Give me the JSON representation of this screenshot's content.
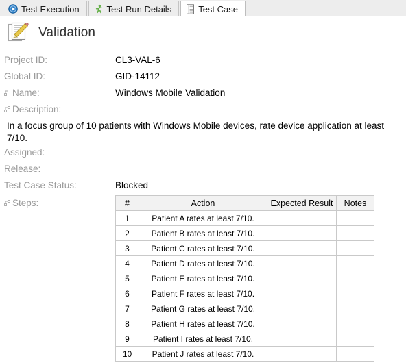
{
  "tabs": [
    {
      "label": "Test Execution",
      "icon": "play-circle-icon",
      "active": false
    },
    {
      "label": "Test Run Details",
      "icon": "runner-icon",
      "active": false
    },
    {
      "label": "Test Case",
      "icon": "document-lines-icon",
      "active": true
    }
  ],
  "header": {
    "title": "Validation",
    "icon": "document-pencil-icon"
  },
  "fields": [
    {
      "label": "Project ID:",
      "value": "CL3-VAL-6",
      "node": false
    },
    {
      "label": "Global ID:",
      "value": "GID-14112",
      "node": false
    },
    {
      "label": "Name:",
      "value": "Windows Mobile Validation",
      "node": true
    }
  ],
  "description": {
    "label": "Description:",
    "node": true,
    "text": "In a focus group of 10 patients with Windows Mobile devices, rate device application at least 7/10."
  },
  "fields2": [
    {
      "label": "Assigned:",
      "value": "",
      "node": false
    },
    {
      "label": "Release:",
      "value": "",
      "node": false
    },
    {
      "label": "Test Case Status:",
      "value": "Blocked",
      "node": false
    }
  ],
  "steps": {
    "label": "Steps:",
    "node": true,
    "columns": [
      "#",
      "Action",
      "Expected Result",
      "Notes"
    ],
    "rows": [
      {
        "num": "1",
        "action": "Patient A rates at least 7/10.",
        "expected": "",
        "notes": ""
      },
      {
        "num": "2",
        "action": "Patient B rates at least 7/10.",
        "expected": "",
        "notes": ""
      },
      {
        "num": "3",
        "action": "Patient C rates at least 7/10.",
        "expected": "",
        "notes": ""
      },
      {
        "num": "4",
        "action": "Patient D rates at least 7/10.",
        "expected": "",
        "notes": ""
      },
      {
        "num": "5",
        "action": "Patient E rates at least 7/10.",
        "expected": "",
        "notes": ""
      },
      {
        "num": "6",
        "action": "Patient F rates at least 7/10.",
        "expected": "",
        "notes": ""
      },
      {
        "num": "7",
        "action": "Patient G rates at least 7/10.",
        "expected": "",
        "notes": ""
      },
      {
        "num": "8",
        "action": "Patient H rates at least 7/10.",
        "expected": "",
        "notes": ""
      },
      {
        "num": "9",
        "action": "Patient I rates at least 7/10.",
        "expected": "",
        "notes": ""
      },
      {
        "num": "10",
        "action": "Patient J rates at least 7/10.",
        "expected": "",
        "notes": ""
      }
    ]
  },
  "colors": {
    "tabbar_bg": "#ededed",
    "label_gray": "#9a9a9a",
    "title_gray": "#333333",
    "table_header_bg": "#f2f2f2",
    "table_border": "#c9c9c9",
    "play_blue": "#2a7fc9",
    "runner_green": "#66b04a",
    "pencil_gold": "#e8c84a"
  }
}
